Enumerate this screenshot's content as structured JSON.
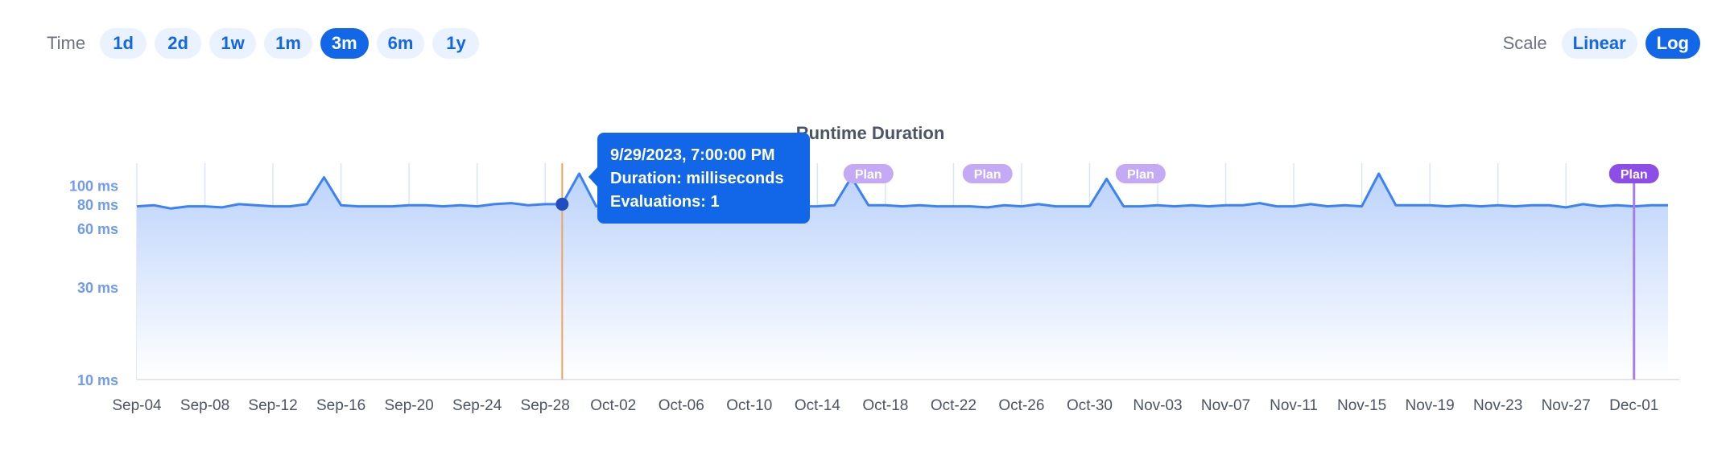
{
  "time": {
    "label": "Time",
    "options": [
      "1d",
      "2d",
      "1w",
      "1m",
      "3m",
      "6m",
      "1y"
    ],
    "selected": "3m"
  },
  "scale": {
    "label": "Scale",
    "options": [
      "Linear",
      "Log"
    ],
    "selected": "Log"
  },
  "colors": {
    "accent": "#1167e8",
    "line": "#3b82f6",
    "fill_top": "#bcd3fb",
    "fill_bottom": "#ffffff",
    "grid": "#d8e6fb",
    "cursor": "#f0a35c",
    "plan_badge": "#c4a9f5",
    "plan_badge_active": "#8d4ee8",
    "plan_line": "#a77cf0"
  },
  "chart_data": {
    "type": "area",
    "title": "Runtime Duration",
    "xlabel": "",
    "ylabel": "",
    "y_scale": "log",
    "grid": "vertical",
    "ylim": [
      10,
      130
    ],
    "y_ticks": [
      {
        "value": 10,
        "label": "10 ms"
      },
      {
        "value": 30,
        "label": "30 ms"
      },
      {
        "value": 60,
        "label": "60 ms"
      },
      {
        "value": 80,
        "label": "80 ms"
      },
      {
        "value": 100,
        "label": "100 ms"
      }
    ],
    "x_ticks": [
      "Sep-04",
      "Sep-08",
      "Sep-12",
      "Sep-16",
      "Sep-20",
      "Sep-24",
      "Sep-28",
      "Oct-02",
      "Oct-06",
      "Oct-10",
      "Oct-14",
      "Oct-18",
      "Oct-22",
      "Oct-26",
      "Oct-30",
      "Nov-03",
      "Nov-07",
      "Nov-11",
      "Nov-15",
      "Nov-19",
      "Nov-23",
      "Nov-27",
      "Dec-01"
    ],
    "x": [
      "2023-09-04",
      "2023-09-05",
      "2023-09-06",
      "2023-09-07",
      "2023-09-08",
      "2023-09-09",
      "2023-09-10",
      "2023-09-11",
      "2023-09-12",
      "2023-09-13",
      "2023-09-14",
      "2023-09-15",
      "2023-09-16",
      "2023-09-17",
      "2023-09-18",
      "2023-09-19",
      "2023-09-20",
      "2023-09-21",
      "2023-09-22",
      "2023-09-23",
      "2023-09-24",
      "2023-09-25",
      "2023-09-26",
      "2023-09-27",
      "2023-09-28",
      "2023-09-29",
      "2023-09-30",
      "2023-10-01",
      "2023-10-02",
      "2023-10-03",
      "2023-10-04",
      "2023-10-05",
      "2023-10-06",
      "2023-10-07",
      "2023-10-08",
      "2023-10-09",
      "2023-10-10",
      "2023-10-11",
      "2023-10-12",
      "2023-10-13",
      "2023-10-14",
      "2023-10-15",
      "2023-10-16",
      "2023-10-17",
      "2023-10-18",
      "2023-10-19",
      "2023-10-20",
      "2023-10-21",
      "2023-10-22",
      "2023-10-23",
      "2023-10-24",
      "2023-10-25",
      "2023-10-26",
      "2023-10-27",
      "2023-10-28",
      "2023-10-29",
      "2023-10-30",
      "2023-10-31",
      "2023-11-01",
      "2023-11-02",
      "2023-11-03",
      "2023-11-04",
      "2023-11-05",
      "2023-11-06",
      "2023-11-07",
      "2023-11-08",
      "2023-11-09",
      "2023-11-10",
      "2023-11-11",
      "2023-11-12",
      "2023-11-13",
      "2023-11-14",
      "2023-11-15",
      "2023-11-16",
      "2023-11-17",
      "2023-11-18",
      "2023-11-19",
      "2023-11-20",
      "2023-11-21",
      "2023-11-22",
      "2023-11-23",
      "2023-11-24",
      "2023-11-25",
      "2023-11-26",
      "2023-11-27",
      "2023-11-28",
      "2023-11-29",
      "2023-11-30",
      "2023-12-01",
      "2023-12-02",
      "2023-12-03"
    ],
    "series": [
      {
        "values": [
          78,
          79,
          76,
          78,
          78,
          77,
          80,
          79,
          78,
          78,
          80,
          110,
          79,
          78,
          78,
          78,
          79,
          79,
          78,
          79,
          78,
          80,
          81,
          79,
          80,
          80,
          115,
          78,
          79,
          78,
          78,
          79,
          78,
          78,
          78,
          78,
          78,
          78,
          78,
          78,
          78,
          79,
          110,
          79,
          79,
          78,
          79,
          78,
          78,
          78,
          77,
          79,
          78,
          80,
          78,
          78,
          78,
          108,
          78,
          78,
          79,
          78,
          79,
          78,
          79,
          79,
          81,
          78,
          78,
          80,
          78,
          79,
          78,
          115,
          79,
          79,
          79,
          78,
          79,
          78,
          79,
          78,
          79,
          79,
          77,
          80,
          78,
          79,
          78,
          79,
          79
        ]
      }
    ],
    "annotations": [
      {
        "label": "Plan",
        "date": "2023-10-17"
      },
      {
        "label": "Plan",
        "date": "2023-10-24"
      },
      {
        "label": "Plan",
        "date": "2023-11-02"
      },
      {
        "label": "Plan",
        "date": "2023-12-01",
        "active": true
      }
    ],
    "tooltip": {
      "date": "2023-09-29",
      "lines": [
        "9/29/2023, 7:00:00 PM",
        "Duration: milliseconds",
        "Evaluations: 1"
      ]
    }
  }
}
